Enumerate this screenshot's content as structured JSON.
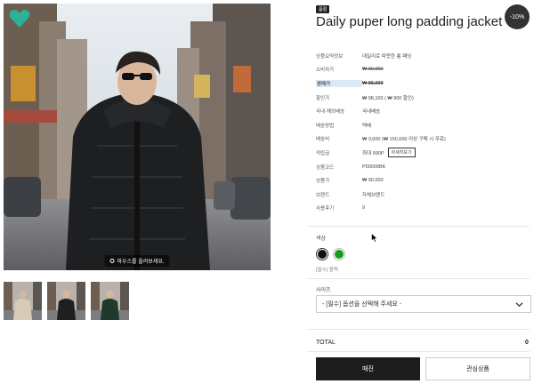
{
  "gallery": {
    "zoom_hint": "마우스를 올려보세요."
  },
  "product": {
    "tag": "품절",
    "title": "Daily puper long padding jacket",
    "discount_badge": "-10%",
    "specs": [
      {
        "label": "상품요약정보",
        "value": "데일리로 따뜻한 롱 패딩"
      },
      {
        "label": "소비자가",
        "value": "₩ 90,000"
      },
      {
        "label": "판매가",
        "value": "₩ 99,000"
      },
      {
        "label": "할인가",
        "value": "₩ 98,100 ( ₩ 900 할인)"
      },
      {
        "label": "국내·해외배송",
        "value": "국내배송"
      },
      {
        "label": "배송방법",
        "value": "택배"
      },
      {
        "label": "배송비",
        "value": "₩ 3,000 (₩ 150,000 이상 구매 시 무료)"
      },
      {
        "label": "적립금",
        "value": "최대 990P",
        "button": "자세히보기"
      },
      {
        "label": "상품코드",
        "value": "P00000BK"
      },
      {
        "label": "상품가",
        "value": "₩ 90,000"
      },
      {
        "label": "브랜드",
        "value": "자체브랜드"
      },
      {
        "label": "사용후기",
        "value": "9"
      }
    ]
  },
  "options": {
    "color_label": "색상",
    "colors": [
      "#111111",
      "#1a9a1a"
    ],
    "required_note": "[필수] 블랙",
    "size_label": "사이즈",
    "size_placeholder": "- [필수] 옵션을 선택해 주세요 -"
  },
  "summary": {
    "total_label": "TOTAL",
    "total_value": "0"
  },
  "actions": {
    "buy": "매진",
    "wishlist": "관심상품"
  },
  "colors": {
    "accent": "#3b6fa8",
    "heart": "#2bb39a",
    "dark": "#1d1d1d"
  }
}
